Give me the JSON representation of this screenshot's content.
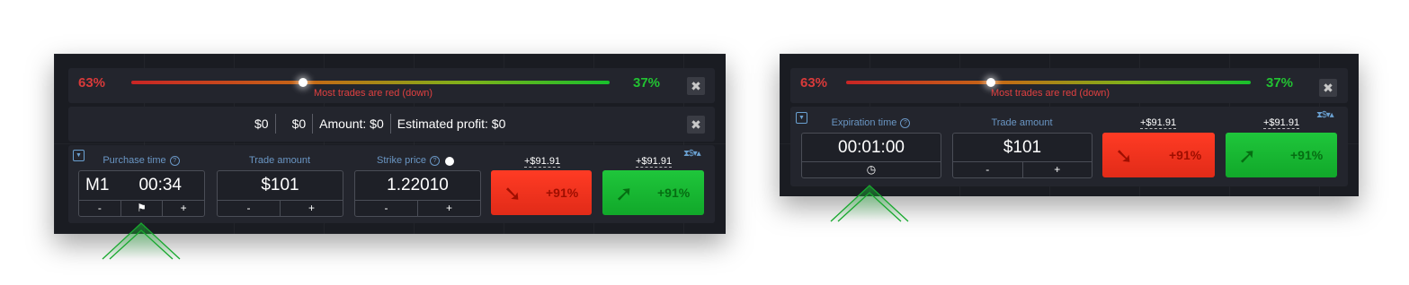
{
  "panels": [
    {
      "sentiment": {
        "red_pct": "63%",
        "green_pct": "37%",
        "message": "Most trades are red (down)",
        "close": "✖",
        "red_share": 0.63
      },
      "amounts": {
        "a1": "$0",
        "a2": "$0",
        "amount": "Amount: $0",
        "profit": "Estimated profit: $0",
        "close": "✖"
      },
      "trade": {
        "collapse_icon": "caret-down-icon",
        "purchase_label": "Purchase time",
        "timeframe": "M1",
        "time": "00:34",
        "minus": "-",
        "plus": "+",
        "flag": "⚑",
        "amount_label": "Trade amount",
        "amount": "$101",
        "strike_label": "Strike price",
        "strike": "1.22010",
        "tools": "⧗$▾▴",
        "payout_down": "+$91.91",
        "payout_up": "+$91.91",
        "down_arrow": "➘",
        "up_arrow": "➚",
        "down_pct": "+91%",
        "up_pct": "+91%"
      }
    },
    {
      "sentiment": {
        "red_pct": "63%",
        "green_pct": "37%",
        "message": "Most trades are red (down)",
        "close": "✖",
        "red_share": 0.63
      },
      "trade": {
        "collapse_icon": "caret-down-icon",
        "expiration_label": "Expiration time",
        "time": "00:01:00",
        "clock": "◷",
        "amount_label": "Trade amount",
        "amount": "$101",
        "minus": "-",
        "plus": "+",
        "tools": "⧗$▾▴",
        "payout_down": "+$91.91",
        "payout_up": "+$91.91",
        "down_arrow": "➘",
        "up_arrow": "➚",
        "down_pct": "+91%",
        "up_pct": "+91%"
      }
    }
  ],
  "colors": {
    "red": "#e12b18",
    "green": "#11a82a",
    "label_blue": "#6a96c4",
    "panel_bg": "#1a1c22"
  }
}
